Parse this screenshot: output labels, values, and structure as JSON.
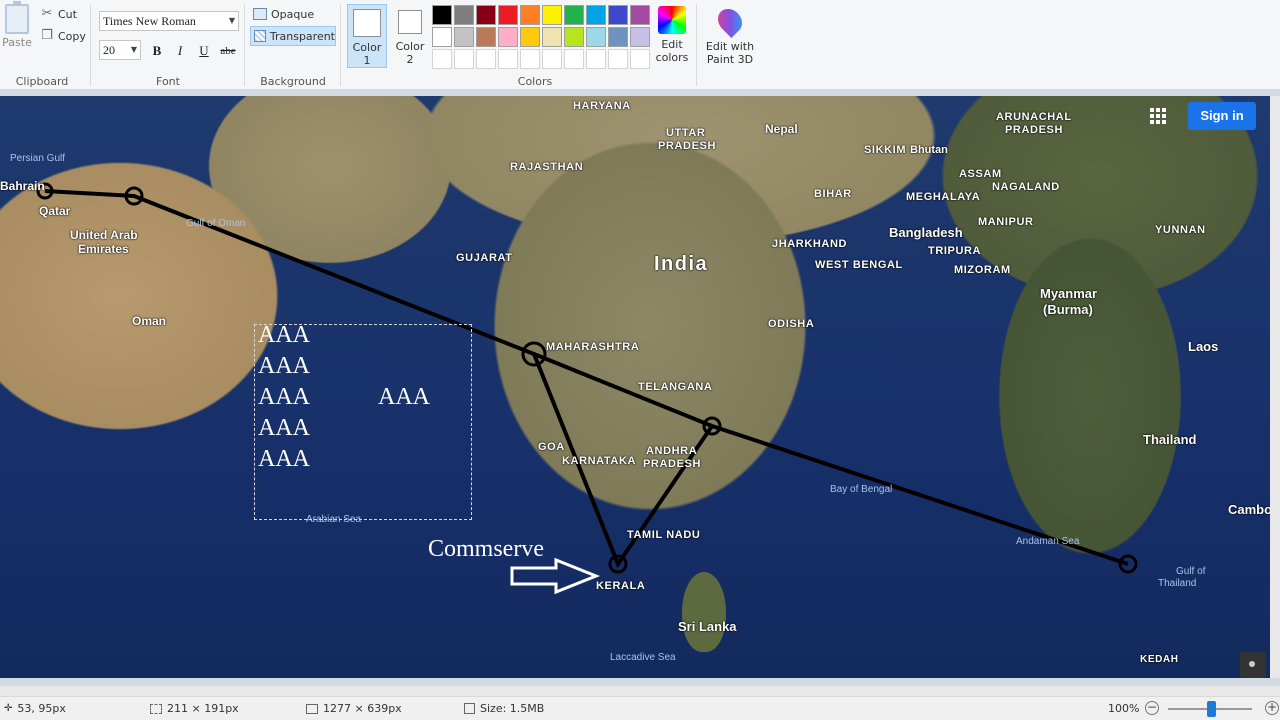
{
  "clipboard": {
    "paste_label": "Paste",
    "cut_label": "Cut",
    "copy_label": "Copy",
    "group_label": "Clipboard"
  },
  "font": {
    "family": "Times New Roman",
    "size": "20",
    "bold": "B",
    "italic": "I",
    "underline": "U",
    "strike": "abe",
    "group_label": "Font"
  },
  "background": {
    "opaque_label": "Opaque",
    "transparent_label": "Transparent",
    "selected": "transparent",
    "group_label": "Background"
  },
  "colors": {
    "color1_label": "Color\n1",
    "color1_line1": "Color",
    "color1_line2": "1",
    "color2_line1": "Color",
    "color2_line2": "2",
    "palette_row1": [
      "#000000",
      "#7f7f7f",
      "#880015",
      "#ed1c24",
      "#ff7f27",
      "#fff200",
      "#22b14c",
      "#00a2e8",
      "#3f48cc",
      "#a349a4"
    ],
    "palette_row2": [
      "#ffffff",
      "#c3c3c3",
      "#b97a57",
      "#ffaec9",
      "#ffc90e",
      "#efe4b0",
      "#b5e61d",
      "#99d9ea",
      "#7092be",
      "#c8bfe7"
    ],
    "edit_line1": "Edit",
    "edit_line2": "colors",
    "group_label": "Colors"
  },
  "paint3d": {
    "line1": "Edit with",
    "line2": "Paint 3D"
  },
  "map": {
    "signin_label": "Sign in",
    "labels": {
      "haryana": "HARYANA",
      "uttar_pradesh_1": "UTTAR",
      "uttar_pradesh_2": "PRADESH",
      "nepal": "Nepal",
      "arunachal_1": "ARUNACHAL",
      "arunachal_2": "PRADESH",
      "persian_gulf": "Persian Gulf",
      "rajasthan": "RAJASTHAN",
      "sikkim": "SIKKIM",
      "bhutan": "Bhutan",
      "bahrain": "Bahrain",
      "qatar": "Qatar",
      "assam": "ASSAM",
      "nagaland": "NAGALAND",
      "bihar": "BIHAR",
      "meghalaya": "MEGHALAYA",
      "uae_1": "United Arab",
      "uae_2": "Emirates",
      "gulf_of_oman": "Gulf of Oman",
      "manipur": "MANIPUR",
      "yunnan": "YUNNAN",
      "jharkhand": "JHARKHAND",
      "bangladesh": "Bangladesh",
      "tripura": "TRIPURA",
      "gujarat": "GUJARAT",
      "india": "India",
      "west_bengal": "WEST BENGAL",
      "mizoram": "MIZORAM",
      "myanmar_1": "Myanmar",
      "myanmar_2": "(Burma)",
      "oman": "Oman",
      "odisha": "ODISHA",
      "maharashtra": "MAHARASHTRA",
      "laos": "Laos",
      "telangana": "TELANGANA",
      "thailand": "Thailand",
      "goa": "GOA",
      "andhra_1": "ANDHRA",
      "andhra_2": "PRADESH",
      "karnataka": "KARNATAKA",
      "bay_of_bengal": "Bay of Bengal",
      "cambodia": "Cambo",
      "arabian_sea": "Arabian Sea",
      "tamil_nadu": "TAMIL NADU",
      "andaman_sea": "Andaman Sea",
      "gulf_thailand_1": "Gulf of",
      "gulf_thailand_2": "Thailand",
      "kerala": "KERALA",
      "sri_lanka": "Sri Lanka",
      "laccadive_sea": "Laccadive Sea",
      "kedah": "KEDAH"
    }
  },
  "canvas_text": {
    "aaa": "AAA",
    "commserve": "Commserve"
  },
  "status": {
    "cursor_pos": "53, 95px",
    "selection_size": "211 × 191px",
    "image_size": "1277 × 639px",
    "file_size": "Size: 1.5MB",
    "zoom": "100%"
  }
}
